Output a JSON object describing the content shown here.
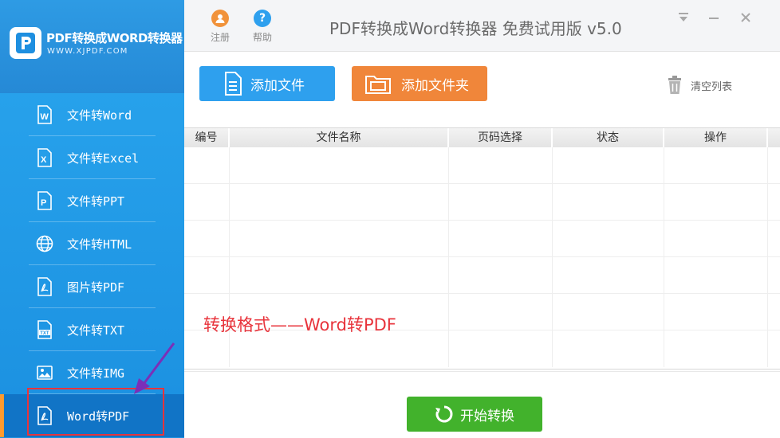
{
  "brand": {
    "title": "PDF转换成WORD转换器",
    "subtitle": "WWW.XJPDF.COM"
  },
  "sidebar": {
    "items": [
      {
        "label": "文件转Word",
        "icon": "word-file-icon"
      },
      {
        "label": "文件转Excel",
        "icon": "excel-file-icon"
      },
      {
        "label": "文件转PPT",
        "icon": "ppt-file-icon"
      },
      {
        "label": "文件转HTML",
        "icon": "globe-icon"
      },
      {
        "label": "图片转PDF",
        "icon": "pdf-file-icon"
      },
      {
        "label": "文件转TXT",
        "icon": "txt-file-icon"
      },
      {
        "label": "文件转IMG",
        "icon": "image-icon"
      },
      {
        "label": "Word转PDF",
        "icon": "pdf-file-icon",
        "active": true
      }
    ]
  },
  "titlebar": {
    "register_label": "注册",
    "help_label": "帮助",
    "help_glyph": "?",
    "app_title": "PDF转换成Word转换器 免费试用版 v5.0"
  },
  "toolbar": {
    "add_file_label": "添加文件",
    "add_folder_label": "添加文件夹",
    "clear_list_label": "清空列表"
  },
  "table": {
    "columns": [
      "编号",
      "文件名称",
      "页码选择",
      "状态",
      "操作"
    ],
    "rows": []
  },
  "annotation": {
    "text": "转换格式——Word转PDF"
  },
  "actions": {
    "start_label": "开始转换"
  },
  "colors": {
    "sidebar_blue": "#2aa6ee",
    "active_item": "#1174c6",
    "add_file_blue": "#2ea0ee",
    "add_folder_orange": "#f0863a",
    "start_green": "#42b22c",
    "annotation_red": "#e8343c"
  }
}
